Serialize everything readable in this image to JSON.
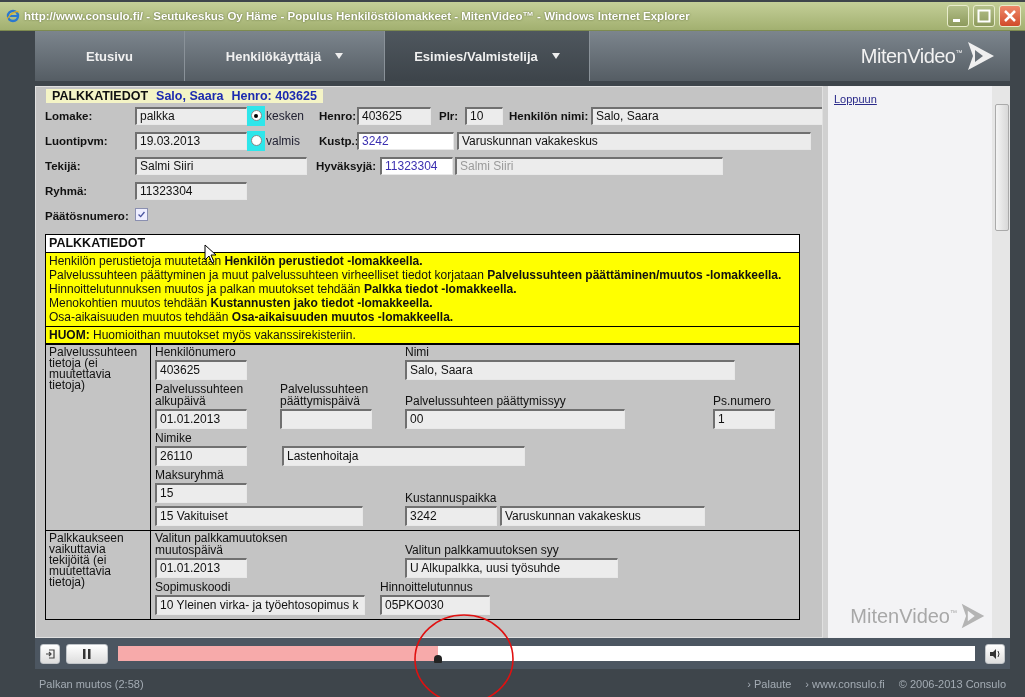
{
  "window": {
    "title": "http://www.consulo.fi/ - Seutukeskus Oy Häme - Populus Henkilöstölomakkeet - MitenVideo™ - Windows Internet Explorer"
  },
  "nav": {
    "tabs": [
      {
        "label": "Etusivu",
        "selected": false,
        "dropdown": false
      },
      {
        "label": "Henkilökäyttäjä",
        "selected": false,
        "dropdown": true
      },
      {
        "label": "Esimies/Valmistelija",
        "selected": true,
        "dropdown": true
      }
    ],
    "logo": "MitenVideo$^{™}$"
  },
  "form": {
    "legend": {
      "title": "PALKKATIEDOT",
      "name": "Salo, Saara",
      "henro": "Henro:  403625"
    },
    "rows": [
      {
        "items": [
          {
            "kind": "label",
            "text": "Lomake:"
          },
          {
            "kind": "field",
            "value": "palkka",
            "editable": false,
            "disabled": false
          },
          {
            "kind": "radio",
            "label": "kesken",
            "selected": true
          },
          {
            "kind": "label",
            "text": "Henro:"
          },
          {
            "kind": "field",
            "value": "403625",
            "editable": false,
            "disabled": false
          },
          {
            "kind": "label",
            "text": "Plr:"
          },
          {
            "kind": "field",
            "value": "10",
            "editable": false,
            "disabled": false
          },
          {
            "kind": "label",
            "text": "Henkilön nimi:"
          },
          {
            "kind": "field",
            "value": "Salo, Saara",
            "editable": false,
            "disabled": false
          }
        ]
      },
      {
        "items": [
          {
            "kind": "label",
            "text": "Luontipvm:"
          },
          {
            "kind": "field",
            "value": "19.03.2013",
            "editable": false,
            "disabled": false
          },
          {
            "kind": "radio",
            "label": "valmis",
            "selected": false
          },
          {
            "kind": "label",
            "text": "Kustp.:"
          },
          {
            "kind": "field",
            "value": "3242",
            "editable": true,
            "disabled": false
          },
          {
            "kind": "field",
            "value": "Varuskunnan vakakeskus",
            "editable": false,
            "disabled": false
          }
        ]
      },
      {
        "items": [
          {
            "kind": "label",
            "text": "Tekijä:"
          },
          {
            "kind": "field",
            "value": "Salmi Siiri",
            "editable": false,
            "disabled": false
          },
          {
            "kind": "label",
            "text": "Hyväksyjä:"
          },
          {
            "kind": "field",
            "value": "11323304",
            "editable": true,
            "disabled": false
          },
          {
            "kind": "field",
            "value": "Salmi Siiri",
            "editable": false,
            "disabled": true
          }
        ]
      },
      {
        "items": [
          {
            "kind": "label",
            "text": "Ryhmä:"
          },
          {
            "kind": "field",
            "value": "11323304",
            "editable": false,
            "disabled": false
          }
        ]
      },
      {
        "items": [
          {
            "kind": "label",
            "text": "Päätösnumero:"
          },
          {
            "kind": "checkbox",
            "checked": true
          }
        ]
      }
    ]
  },
  "info": {
    "title": "PALKKATIEDOT",
    "lines": [
      "Henkilön perustietoja muutetaan **Henkilön perustiedot -lomakkeella.**",
      "Palvelussuhteen päättyminen ja muut palvelussuhteen virheelliset tiedot korjataan **Palvelussuhteen päättäminen/muutos -lomakkeella.**",
      "Hinnoittelutunnuksen muutos ja palkan muutokset tehdään **Palkka tiedot -lomakkeella.**",
      "Menokohtien muutos tehdään **Kustannusten jako tiedot -lomakkeella.**",
      "Osa-aikaisuuden muutos tehdään **Osa-aikaisuuden muutos -lomakkeella.**"
    ],
    "note": "**HUOM:** Huomioithan muutokset myös vakanssirekisteriin."
  },
  "sections": [
    {
      "label": "Palvelussuhteen tietoja (ei muutettavia tietoja)",
      "rows": [
        [
          {
            "label": "Henkilönumero",
            "fields": [
              {
                "value": "403625"
              }
            ]
          },
          {
            "label": "Nimi",
            "fields": [
              {
                "value": "Salo, Saara"
              }
            ]
          }
        ],
        [
          {
            "label": "Palvelussuhteen alkupäivä",
            "fields": [
              {
                "value": "01.01.2013"
              }
            ]
          },
          {
            "label": "Palvelussuhteen päättymispäivä"
          },
          {
            "label": "Palvelussuhteen päättymissyy",
            "fields": [
              {
                "value": "00"
              }
            ]
          },
          {
            "label": "Ps.numero",
            "fields": [
              {
                "value": "1"
              }
            ]
          }
        ],
        [
          {
            "label": "Nimike",
            "fields": [
              {
                "value": "26110"
              },
              {
                "value": "Lastenhoitaja"
              }
            ]
          }
        ],
        [
          {
            "label": "Maksuryhmä",
            "fields": [
              {
                "value": "15"
              },
              {
                "value": "15 Vakituiset"
              }
            ]
          },
          {
            "label": "Kustannuspaikka",
            "fields": [
              {
                "value": "3242"
              },
              {
                "value": "Varuskunnan vakakeskus"
              }
            ]
          }
        ]
      ]
    },
    {
      "label": "Palkkaukseen vaikuttavia tekijöitä (ei muutettavia tietoja)",
      "rows": [
        [
          {
            "label": "Valitun palkkamuutoksen muutospäivä",
            "fields": [
              {
                "value": "01.01.2013"
              }
            ]
          },
          {
            "label": "Valitun palkkamuutoksen syy",
            "fields": [
              {
                "value": "U Alkupalkka, uusi työsuhde"
              }
            ]
          }
        ],
        [
          {
            "label": "Sopimuskoodi",
            "fields": [
              {
                "value": "10 Yleinen virka- ja työehtosopimus k"
              }
            ]
          },
          {
            "label": "Hinnoittelutunnus",
            "fields": [
              {
                "value": "05PKO030"
              }
            ]
          }
        ]
      ]
    }
  ],
  "side": {
    "link": "Loppuun",
    "logo": "MitenVideo$^{™}$"
  },
  "player": {
    "level": 0.373
  },
  "status": {
    "caption": "Palkan muutos (2:58)",
    "links": [
      "› Palaute",
      "› www.consulo.fi"
    ],
    "copyright": "© 2006-2013 Consulo"
  }
}
